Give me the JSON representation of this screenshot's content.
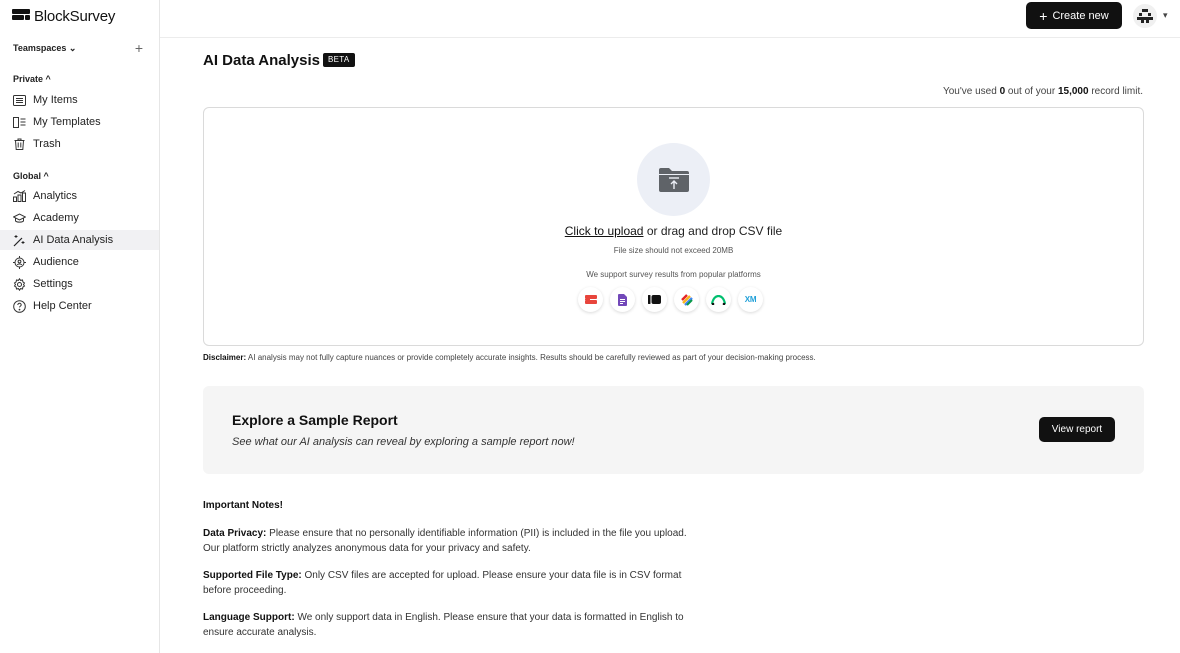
{
  "app": {
    "name": "BlockSurvey"
  },
  "sidebar": {
    "teamspaces_label": "Teamspaces",
    "add_symbol": "+",
    "private_title": "Private",
    "private_items": [
      {
        "label": "My Items",
        "icon": "list-icon"
      },
      {
        "label": "My Templates",
        "icon": "templates-icon"
      },
      {
        "label": "Trash",
        "icon": "trash-icon"
      }
    ],
    "global_title": "Global",
    "global_items": [
      {
        "label": "Analytics",
        "icon": "analytics-icon"
      },
      {
        "label": "Academy",
        "icon": "graduation-cap-icon"
      },
      {
        "label": "AI Data Analysis",
        "icon": "magic-wand-icon",
        "active": true
      },
      {
        "label": "Audience",
        "icon": "audience-icon"
      },
      {
        "label": "Settings",
        "icon": "gear-icon"
      },
      {
        "label": "Help Center",
        "icon": "help-icon"
      }
    ]
  },
  "header": {
    "create_label": "Create new",
    "create_symbol": "+"
  },
  "main": {
    "title": "AI Data Analysis",
    "badge": "BETA",
    "usage": {
      "prefix": "You've used ",
      "used": "0",
      "middle": " out of your ",
      "limit": "15,000",
      "suffix": " record limit."
    },
    "upload": {
      "link_text": "Click to upload",
      "rest_text": " or drag and drop CSV file",
      "size_note": "File size should not exceed 20MB",
      "support_text": "We support survey results from popular platforms",
      "platforms": [
        "typeform-icon",
        "google-forms-icon",
        "jotform-icon",
        "zoho-icon",
        "surveymonkey-icon",
        "qualtrics-icon"
      ],
      "qualtrics_label": "XM"
    },
    "disclaimer": {
      "label": "Disclaimer:",
      "text": " AI analysis may not fully capture nuances or provide completely accurate insights. Results should be carefully reviewed as part of your decision-making process."
    },
    "sample": {
      "title": "Explore a Sample Report",
      "subtitle": "See what our AI analysis can reveal by exploring a sample report now!",
      "button": "View report"
    },
    "notes": {
      "title": "Important Notes!",
      "items": [
        {
          "label": "Data Privacy:",
          "text": " Please ensure that no personally identifiable information (PII) is included in the file you upload. Our platform strictly analyzes anonymous data for your privacy and safety."
        },
        {
          "label": "Supported File Type:",
          "text": " Only CSV files are accepted for upload. Please ensure your data file is in CSV format before proceeding."
        },
        {
          "label": "Language Support:",
          "text": " We only support data in English. Please ensure that your data is formatted in English to ensure accurate analysis."
        }
      ]
    }
  }
}
